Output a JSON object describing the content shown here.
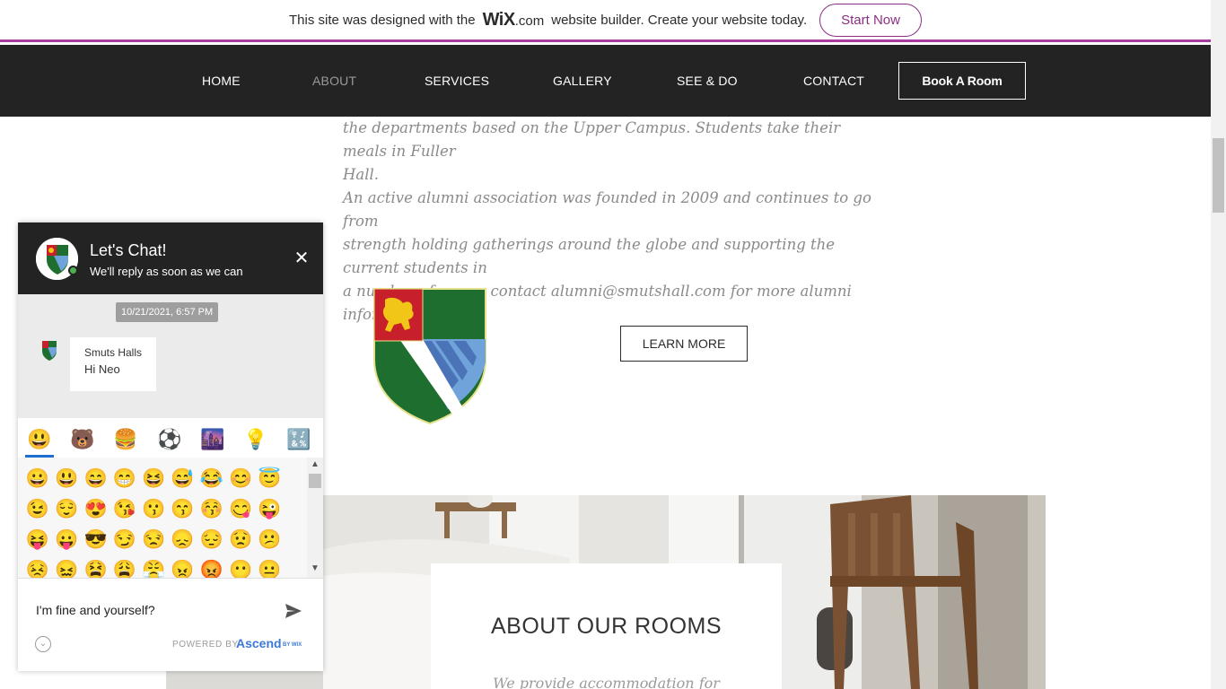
{
  "wix_banner": {
    "text_before": "This site was designed with the",
    "logo": "WiX",
    "logo_suffix": ".com",
    "text_after": "website builder. Create your website today.",
    "cta": "Start Now"
  },
  "nav": {
    "items": [
      {
        "label": "HOME"
      },
      {
        "label": "ABOUT"
      },
      {
        "label": "SERVICES"
      },
      {
        "label": "GALLERY"
      },
      {
        "label": "SEE & DO"
      },
      {
        "label": "CONTACT"
      }
    ],
    "active": "ABOUT",
    "book_label": "Book A Room"
  },
  "content": {
    "para1_line1": "the departments based on the Upper Campus. Students take their meals in Fuller",
    "para1_line2": "Hall.",
    "para2_line1": "An active alumni association was founded in 2009 and continues to go from",
    "para2_line2": "strength holding gatherings around the globe and supporting the current students in",
    "para2_line3": "a number of ways - contact alumni@smutshall.com for more alumni information.",
    "learn_more": "LEARN MORE",
    "about_title": "ABOUT OUR ROOMS",
    "about_sub": "We provide accommodation for"
  },
  "chat": {
    "title": "Let's Chat!",
    "subtitle": "We'll reply as soon as we can",
    "close_icon": "close-icon",
    "timestamp": "10/21/2021, 6:57 PM",
    "message": {
      "sender": "Smuts Halls",
      "text": "Hi Neo"
    },
    "emoji_tabs": [
      "😃",
      "🐻",
      "🍔",
      "⚽",
      "🌆",
      "💡",
      "🔣"
    ],
    "emojis": [
      [
        "😀",
        "😃",
        "😄",
        "😁",
        "😆",
        "😅",
        "😂",
        "😊",
        "😇"
      ],
      [
        "😉",
        "😌",
        "😍",
        "😘",
        "😗",
        "😙",
        "😚",
        "😋",
        "😜"
      ],
      [
        "😝",
        "😛",
        "😎",
        "😏",
        "😒",
        "😞",
        "😔",
        "😟",
        "😕"
      ],
      [
        "😣",
        "😖",
        "😫",
        "😩",
        "😤",
        "😠",
        "😡",
        "😶",
        "😐"
      ]
    ],
    "input_value": "I'm fine and yourself?",
    "powered_by": "POWERED BY",
    "brand": "Ascend",
    "brand_suffix": "BY WIX"
  },
  "colors": {
    "nav_bg": "#232323",
    "banner_accent": "#a83b9e",
    "crest_green": "#1e6e2f",
    "crest_red": "#c8202a",
    "crest_blue": "#6fa3d9",
    "ascend_blue": "#3b79d6",
    "online_green": "#4caf50"
  }
}
